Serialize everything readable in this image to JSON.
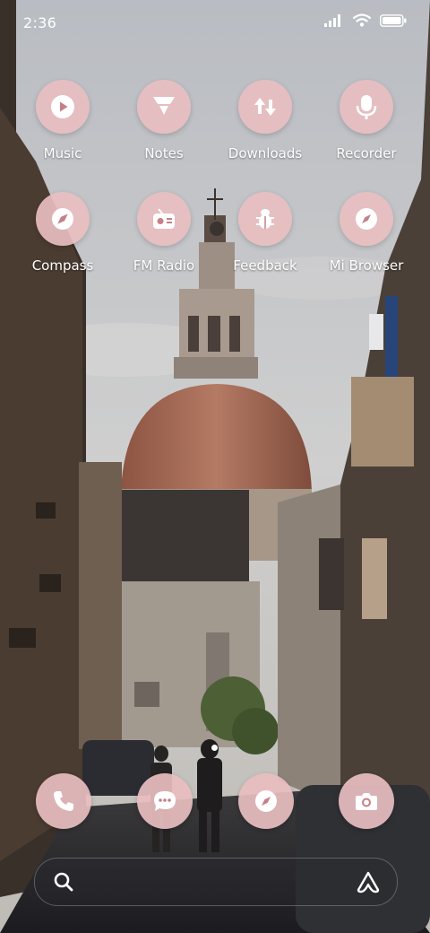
{
  "status_bar": {
    "time": "2:36"
  },
  "apps": [
    {
      "label": "Music",
      "icon": "play-circle-icon"
    },
    {
      "label": "Notes",
      "icon": "notes-funnel-icon"
    },
    {
      "label": "Downloads",
      "icon": "download-arrows-icon"
    },
    {
      "label": "Recorder",
      "icon": "microphone-icon"
    },
    {
      "label": "Compass",
      "icon": "compass-icon"
    },
    {
      "label": "FM Radio",
      "icon": "radio-icon"
    },
    {
      "label": "Feedback",
      "icon": "bug-icon"
    },
    {
      "label": "Mi Browser",
      "icon": "compass-browser-icon"
    }
  ],
  "dock": [
    {
      "icon": "phone-icon"
    },
    {
      "icon": "messages-icon"
    },
    {
      "icon": "browser-icon"
    },
    {
      "icon": "camera-icon"
    }
  ],
  "search_bar": {
    "left_icon": "search-icon",
    "right_icon": "assistant-icon"
  },
  "colors": {
    "icon_bubble": "#e8bec0",
    "icon_glyph": "#c77f87"
  }
}
